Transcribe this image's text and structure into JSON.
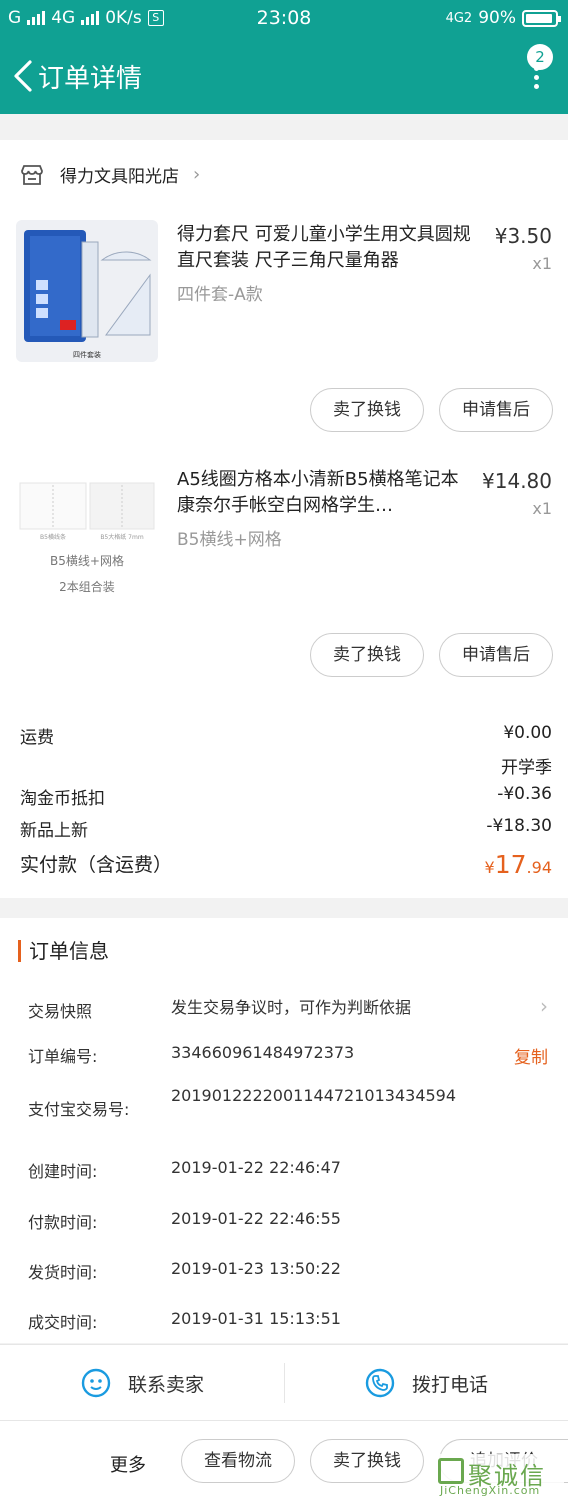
{
  "status": {
    "network_left": "G",
    "network_4g": "4G",
    "speed": "0K/s",
    "s_icon": "S",
    "time": "23:08",
    "network_right": "4G2",
    "battery": "90%"
  },
  "header": {
    "title": "订单详情",
    "badge": "2"
  },
  "shop": {
    "name": "得力文具阳光店"
  },
  "items": [
    {
      "title": "得力套尺 可爱儿童小学生用文具圆规直尺套装 尺子三角尺量角器",
      "sku": "四件套-A款",
      "price": "¥3.50",
      "qty": "x1",
      "thumb_caption": "四件套装",
      "btn_sell": "卖了换钱",
      "btn_service": "申请售后"
    },
    {
      "title": "A5线圈方格本小清新B5横格笔记本康奈尔手帐空白网格学生…",
      "sku": "B5横线+网格",
      "price": "¥14.80",
      "qty": "x1",
      "thumb_label1": "B5横线+网格",
      "thumb_label2": "2本组合装",
      "thumb_small1": "B5横线条",
      "thumb_small2": "B5大格纸 7mm",
      "btn_sell": "卖了换钱",
      "btn_service": "申请售后"
    }
  ],
  "fees": {
    "shipping_label": "运费",
    "shipping_value": "¥0.00",
    "promo_label": "开学季",
    "coin_label": "淘金币抵扣",
    "coin_value": "-¥0.36",
    "new_label": "新品上新",
    "new_value": "-¥18.30",
    "total_label": "实付款（含运费）",
    "total_currency": "¥",
    "total_int": "17",
    "total_dec": ".94"
  },
  "order_info": {
    "title": "订单信息",
    "snapshot_label": "交易快照",
    "snapshot_value": "发生交易争议时，可作为判断依据",
    "order_no_label": "订单编号:",
    "order_no_value": "334660961484972373",
    "copy_label": "复制",
    "alipay_label": "支付宝交易号:",
    "alipay_value": "2019012222001144721013434594",
    "created_label": "创建时间:",
    "created_value": "2019-01-22 22:46:47",
    "paid_label": "付款时间:",
    "paid_value": "2019-01-22 22:46:55",
    "shipped_label": "发货时间:",
    "shipped_value": "2019-01-23 13:50:22",
    "done_label": "成交时间:",
    "done_value": "2019-01-31 15:13:51"
  },
  "contact": {
    "seller": "联系卖家",
    "phone": "拨打电话"
  },
  "bottom": {
    "more": "更多",
    "logistics": "查看物流",
    "sell": "卖了换钱",
    "review": "追加评价"
  },
  "watermark": {
    "text": "聚诚信",
    "site": "JiChengXin.com"
  },
  "colors": {
    "header": "#10a193",
    "accent": "#e5611e"
  }
}
